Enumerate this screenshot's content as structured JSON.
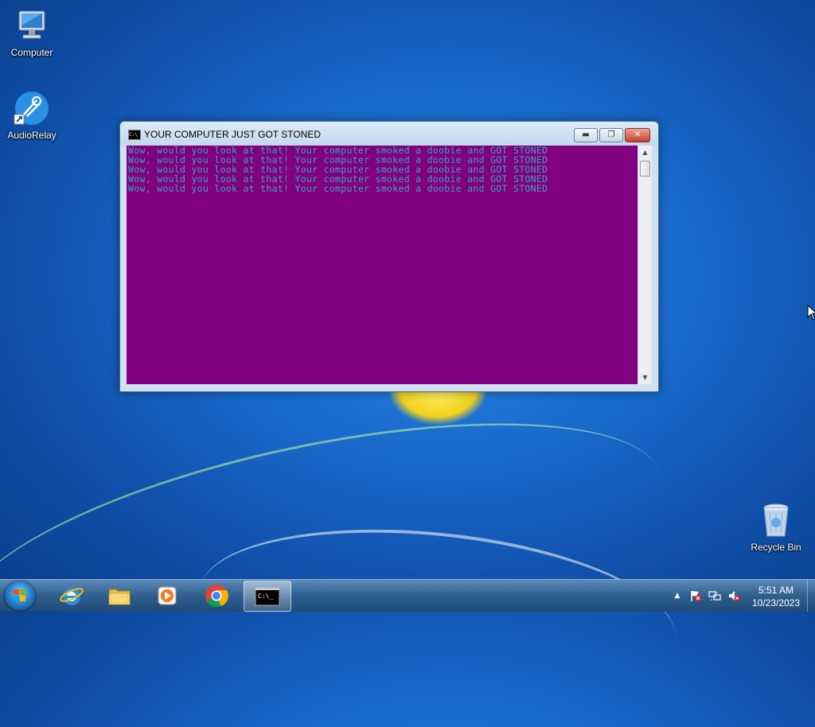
{
  "desktop": {
    "icons": [
      {
        "label": "Computer",
        "icon": "computer-icon"
      },
      {
        "label": "AudioRelay",
        "icon": "audiorelay-icon"
      },
      {
        "label": "Recycle Bin",
        "icon": "recycle-bin-icon"
      }
    ]
  },
  "console_window": {
    "title": "YOUR COMPUTER JUST GOT STONED",
    "icon": "cmd-icon",
    "buttons": {
      "minimize": "minimize-icon",
      "maximize": "maximize-icon",
      "close": "close-icon"
    },
    "background_color": "#800080",
    "text_color": "#3aa0c8",
    "lines": [
      "Wow, would you look at that! Your computer smoked a doobie and GOT STONED",
      "Wow, would you look at that! Your computer smoked a doobie and GOT STONED",
      "Wow, would you look at that! Your computer smoked a doobie and GOT STONED",
      "Wow, would you look at that! Your computer smoked a doobie and GOT STONED",
      "Wow, would you look at that! Your computer smoked a doobie and GOT STONED"
    ]
  },
  "taskbar": {
    "start": "windows-start-icon",
    "pinned": [
      {
        "name": "internet-explorer",
        "icon": "internet-explorer-icon"
      },
      {
        "name": "file-explorer",
        "icon": "folder-icon"
      },
      {
        "name": "media-player",
        "icon": "media-player-icon"
      },
      {
        "name": "chrome",
        "icon": "chrome-icon"
      },
      {
        "name": "command-prompt",
        "icon": "cmd-icon",
        "active": true
      }
    ],
    "tray": {
      "icons": [
        "show-hidden-icons-arrow",
        "action-center-flag-icon",
        "network-icon",
        "volume-muted-icon"
      ],
      "time": "5:51 AM",
      "date": "10/23/2023"
    }
  }
}
